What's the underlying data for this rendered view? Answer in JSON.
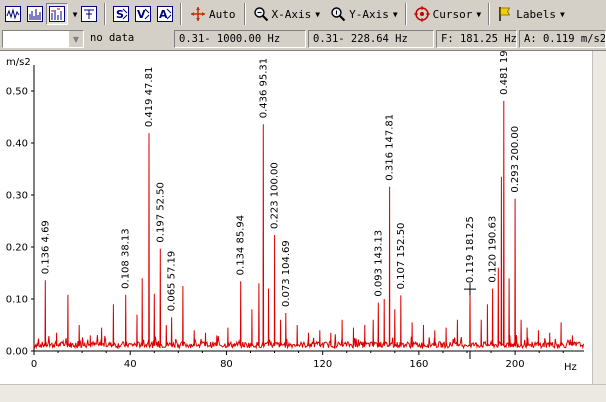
{
  "toolbar": {
    "auto_label": "Auto",
    "xaxis_label": "X-Axis",
    "yaxis_label": "Y-Axis",
    "cursor_label": "Cursor",
    "labels_label": "Labels",
    "icons": [
      "waveform-icon",
      "spectrum-icon",
      "spectrum-peaks-icon",
      "marker-icon",
      "s-scale-icon",
      "v-scale-icon",
      "a-scale-icon",
      "auto-crosshair-icon",
      "magnifier-icon",
      "y-magnifier-icon",
      "cursor-target-icon",
      "flag-icon"
    ]
  },
  "status": {
    "channel_value": "",
    "no_data": "no data",
    "range1": "0.31- 1000.00 Hz",
    "range2": "0.31- 228.64 Hz",
    "freq": "F: 181.25 Hz",
    "amp": "A: 0.119 m/s2"
  },
  "colors": {
    "trace": "#dd0000",
    "background": "#ffffff",
    "panel": "#d4d0c8"
  },
  "chart_data": {
    "type": "line",
    "ylabel": "m/s2",
    "xlabel": "Hz",
    "xlim": [
      0,
      228.64
    ],
    "ylim": [
      0,
      0.55
    ],
    "x_ticks": [
      "0",
      "40",
      "80",
      "120",
      "160",
      "200"
    ],
    "y_ticks": [
      "0.00",
      "0.10",
      "0.20",
      "0.30",
      "0.40",
      "0.50"
    ],
    "grid": false,
    "cursor": {
      "x": 181.25,
      "y": 0.119
    },
    "labeled_peaks": [
      {
        "x": 4.69,
        "y": 0.136,
        "label": "0.136  4.69"
      },
      {
        "x": 38.13,
        "y": 0.108,
        "label": "0.108  38.13"
      },
      {
        "x": 47.81,
        "y": 0.419,
        "label": "0.419  47.81"
      },
      {
        "x": 52.5,
        "y": 0.197,
        "label": "0.197  52.50"
      },
      {
        "x": 57.19,
        "y": 0.065,
        "label": "0.065  57.19"
      },
      {
        "x": 85.94,
        "y": 0.134,
        "label": "0.134  85.94"
      },
      {
        "x": 95.31,
        "y": 0.436,
        "label": "0.436  95.31"
      },
      {
        "x": 100.0,
        "y": 0.223,
        "label": "0.223  100.00"
      },
      {
        "x": 104.69,
        "y": 0.073,
        "label": "0.073  104.69"
      },
      {
        "x": 143.13,
        "y": 0.093,
        "label": "0.093  143.13"
      },
      {
        "x": 147.81,
        "y": 0.316,
        "label": "0.316  147.81"
      },
      {
        "x": 152.5,
        "y": 0.107,
        "label": "0.107  152.50"
      },
      {
        "x": 181.25,
        "y": 0.119,
        "label": "0.119  181.25"
      },
      {
        "x": 190.63,
        "y": 0.12,
        "label": "0.120  190.63"
      },
      {
        "x": 195.31,
        "y": 0.481,
        "label": "0.481  195.31"
      },
      {
        "x": 200.0,
        "y": 0.293,
        "label": "0.293  200.00"
      }
    ],
    "peaks": [
      [
        4.69,
        0.136
      ],
      [
        9.4,
        0.035
      ],
      [
        14.1,
        0.108
      ],
      [
        18.8,
        0.05
      ],
      [
        23.4,
        0.03
      ],
      [
        28.1,
        0.045
      ],
      [
        33.0,
        0.09
      ],
      [
        38.13,
        0.108
      ],
      [
        42.8,
        0.07
      ],
      [
        45.0,
        0.14
      ],
      [
        47.81,
        0.419
      ],
      [
        50.0,
        0.11
      ],
      [
        52.5,
        0.197
      ],
      [
        55.0,
        0.05
      ],
      [
        57.19,
        0.065
      ],
      [
        61.9,
        0.125
      ],
      [
        66.6,
        0.04
      ],
      [
        71.3,
        0.035
      ],
      [
        76.0,
        0.03
      ],
      [
        80.6,
        0.045
      ],
      [
        85.94,
        0.134
      ],
      [
        90.6,
        0.08
      ],
      [
        93.5,
        0.13
      ],
      [
        95.31,
        0.436
      ],
      [
        97.5,
        0.12
      ],
      [
        100.0,
        0.223
      ],
      [
        102.5,
        0.06
      ],
      [
        104.69,
        0.073
      ],
      [
        109.4,
        0.05
      ],
      [
        114.1,
        0.035
      ],
      [
        118.8,
        0.04
      ],
      [
        123.4,
        0.035
      ],
      [
        128.1,
        0.06
      ],
      [
        132.8,
        0.045
      ],
      [
        137.5,
        0.05
      ],
      [
        141.0,
        0.06
      ],
      [
        143.13,
        0.093
      ],
      [
        145.6,
        0.1
      ],
      [
        147.81,
        0.316
      ],
      [
        150.0,
        0.08
      ],
      [
        152.5,
        0.107
      ],
      [
        157.2,
        0.055
      ],
      [
        161.9,
        0.05
      ],
      [
        166.6,
        0.04
      ],
      [
        171.3,
        0.045
      ],
      [
        176.0,
        0.06
      ],
      [
        181.25,
        0.119
      ],
      [
        185.9,
        0.06
      ],
      [
        188.5,
        0.09
      ],
      [
        190.63,
        0.12
      ],
      [
        193.0,
        0.16
      ],
      [
        194.3,
        0.335
      ],
      [
        195.31,
        0.481
      ],
      [
        197.5,
        0.14
      ],
      [
        200.0,
        0.293
      ],
      [
        202.5,
        0.06
      ],
      [
        205.0,
        0.045
      ],
      [
        209.7,
        0.04
      ],
      [
        214.4,
        0.035
      ],
      [
        219.1,
        0.055
      ],
      [
        223.8,
        0.03
      ]
    ]
  }
}
